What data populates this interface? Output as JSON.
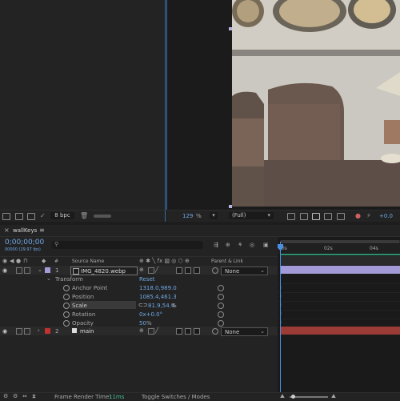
{
  "project": {
    "bpc": "8 bpc"
  },
  "viewer": {
    "zoom": "129",
    "zoom_unit": "%",
    "resolution": "(Full)",
    "exposure": "+0.0"
  },
  "timeline": {
    "comp_tab": "wallKeys",
    "timecode": "0;00;00;00",
    "frame_info": "00000 (29.97 fps)",
    "search_placeholder": "",
    "columns": {
      "hash": "#",
      "source_name": "Source Name",
      "parent_link": "Parent & Link"
    },
    "ruler": {
      "labels": [
        "00s",
        "02s",
        "04s"
      ]
    },
    "layers": [
      {
        "index": "1",
        "name": "IMG_4820.webp",
        "parent": "None",
        "color": "#a39bd8"
      },
      {
        "index": "2",
        "name": "main",
        "parent": "None",
        "color": "#c0322f"
      }
    ],
    "transform": {
      "label": "Transform",
      "reset": "Reset",
      "properties": [
        {
          "name": "Anchor Point",
          "value": "1318.0,989.0"
        },
        {
          "name": "Position",
          "value": "1085.4,461.3"
        },
        {
          "name": "Scale",
          "link": "⊂⊃",
          "value": "81.9,54.4",
          "unit": "%"
        },
        {
          "name": "Rotation",
          "value": "0x+0.0°"
        },
        {
          "name": "Opacity",
          "value": "50",
          "unit": "%"
        }
      ]
    },
    "footer": {
      "render_label": "Frame Render Time:",
      "render_value": "11ms",
      "toggle": "Toggle Switches / Modes"
    }
  },
  "colors": {
    "accent": "#3a6ea5",
    "value_blue": "#6fa8e6",
    "layer1_bar": "#a39bd8",
    "layer2_bar": "#9b3b35"
  }
}
